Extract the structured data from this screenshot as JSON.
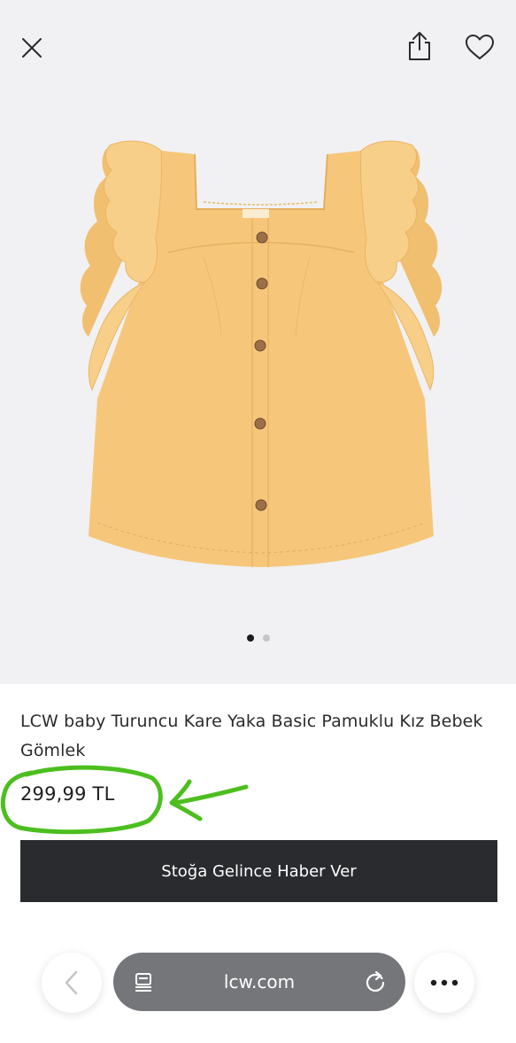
{
  "product": {
    "title": "LCW baby Turuncu Kare Yaka Basic Pamuklu Kız Bebek Gömlek",
    "price": "299,99 TL",
    "cta_label": "Stoğa Gelince Haber Ver",
    "image_label": "LCW baby",
    "gallery_count": 2,
    "gallery_active": 1
  },
  "browser": {
    "url": "lcw.com"
  },
  "icons": {
    "close": "close-icon",
    "share": "share-icon",
    "favorite": "heart-icon",
    "back": "chevron-left-icon",
    "reader": "reader-icon",
    "reload": "reload-icon",
    "more": "more-icon"
  },
  "colors": {
    "cta_background": "#2a2b2f",
    "annotation_green": "#4cbf1f",
    "shirt": "#f6c77a"
  }
}
